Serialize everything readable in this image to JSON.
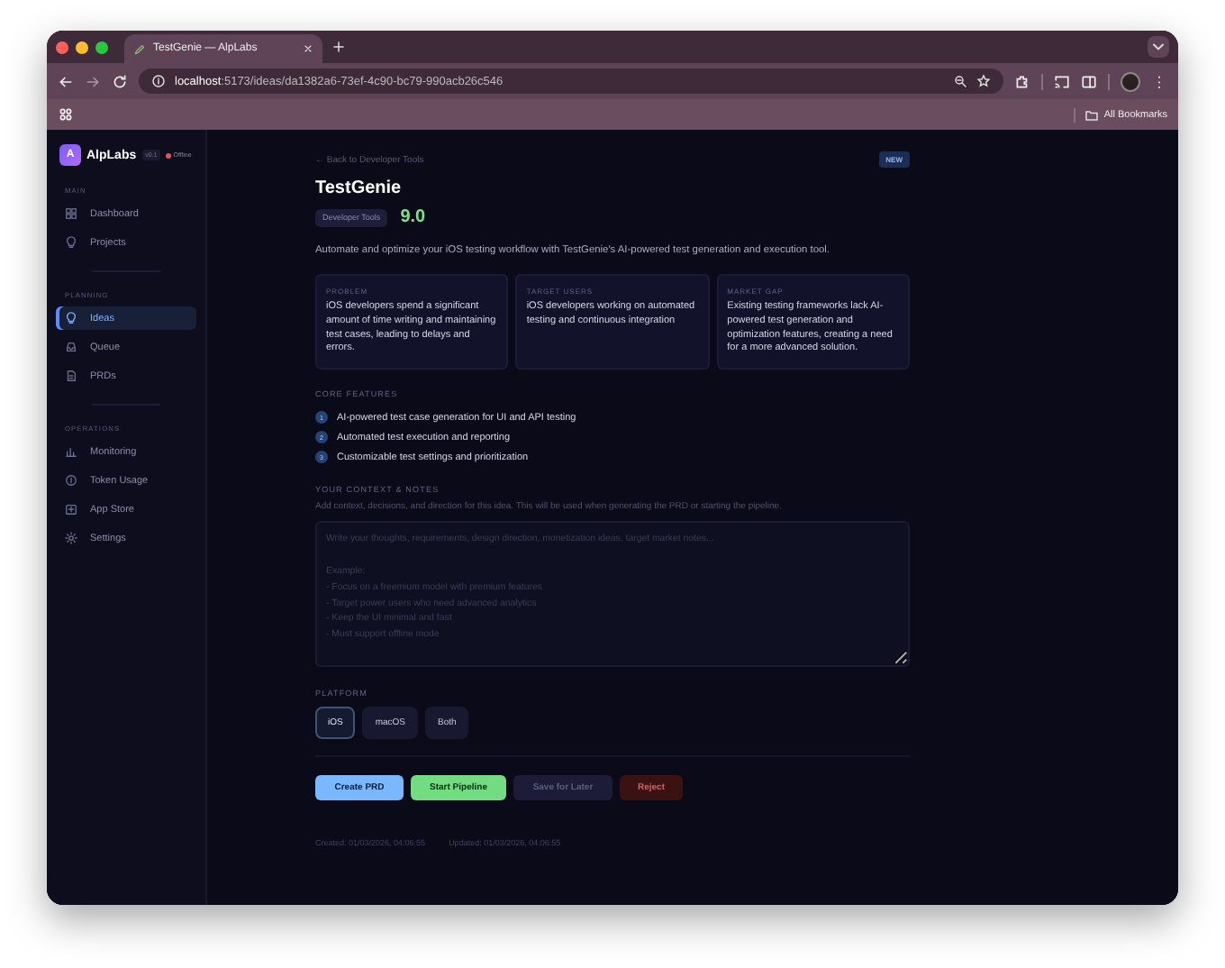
{
  "browser": {
    "tab_title": "TestGenie — AlpLabs",
    "url_host": "localhost",
    "url_path": ":5173/ideas/da1382a6-73ef-4c90-bc79-990acb26c546",
    "bookmarks_label": "All Bookmarks"
  },
  "sidebar": {
    "brand": "AlpLabs",
    "logo_letter": "A",
    "version": "v0.1",
    "status": "Offline",
    "sections": [
      {
        "title": "MAIN",
        "items": [
          {
            "label": "Dashboard",
            "selected": false
          },
          {
            "label": "Projects",
            "selected": false
          }
        ]
      },
      {
        "title": "PLANNING",
        "items": [
          {
            "label": "Ideas",
            "selected": true
          },
          {
            "label": "Queue",
            "selected": false
          },
          {
            "label": "PRDs",
            "selected": false
          }
        ]
      },
      {
        "title": "OPERATIONS",
        "items": [
          {
            "label": "Monitoring",
            "selected": false
          },
          {
            "label": "Token Usage",
            "selected": false
          },
          {
            "label": "App Store",
            "selected": false
          },
          {
            "label": "Settings",
            "selected": false
          }
        ]
      }
    ]
  },
  "idea": {
    "back_link": "← Back to Developer Tools",
    "status_badge": "NEW",
    "title": "TestGenie",
    "category": "Developer Tools",
    "score": "9.0",
    "description": "Automate and optimize your iOS testing workflow with TestGenie's AI-powered test generation and execution tool.",
    "cards": [
      {
        "title": "PROBLEM",
        "text": "iOS developers spend a significant amount of time writing and maintaining test cases, leading to delays and errors."
      },
      {
        "title": "TARGET USERS",
        "text": "iOS developers working on automated testing and continuous integration"
      },
      {
        "title": "MARKET GAP",
        "text": "Existing testing frameworks lack AI-powered test generation and optimization features, creating a need for a more advanced solution."
      }
    ],
    "features_title": "CORE FEATURES",
    "features": [
      {
        "number": "1",
        "text": "AI-powered test case generation for UI and API testing"
      },
      {
        "number": "2",
        "text": "Automated test execution and reporting"
      },
      {
        "number": "3",
        "text": "Customizable test settings and prioritization"
      }
    ],
    "notes_title": "YOUR CONTEXT & NOTES",
    "notes_hint": "Add context, decisions, and direction for this idea. This will be used when generating the PRD or starting the pipeline.",
    "notes_field": {
      "placeholder": "Write your thoughts, requirements, design direction, monetization ideas, target market notes...\n\nExample:\n- Focus on a freemium model with premium features\n- Target power users who need advanced analytics\n- Keep the UI minimal and fast\n- Must support offline mode"
    },
    "platform_title": "PLATFORM",
    "platforms": [
      {
        "label": "iOS",
        "selected": true
      },
      {
        "label": "macOS",
        "selected": false
      },
      {
        "label": "Both",
        "selected": false
      }
    ],
    "actions": [
      {
        "label": "Create PRD",
        "kind": "primary"
      },
      {
        "label": "Start Pipeline",
        "kind": "success"
      },
      {
        "label": "Save for Later",
        "kind": "muted"
      },
      {
        "label": "Reject",
        "kind": "danger"
      }
    ],
    "created": "Created: 01/03/2026, 04:06:55",
    "updated": "Updated: 01/03/2026, 04:06:55"
  }
}
